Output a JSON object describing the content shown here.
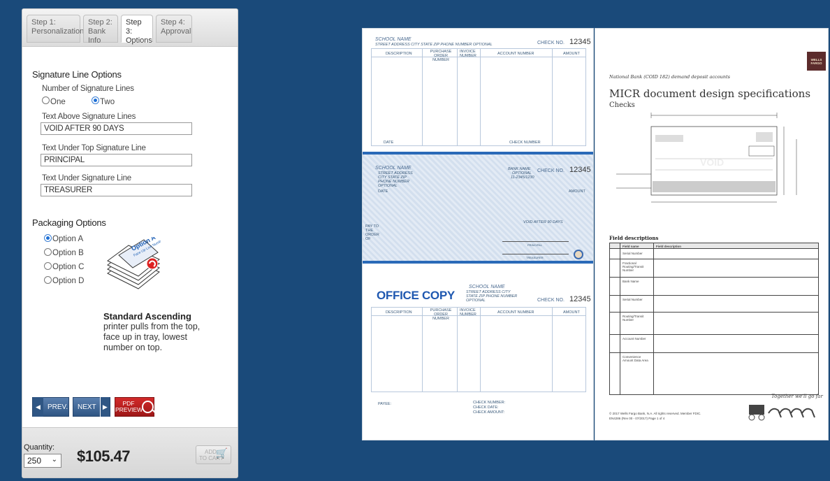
{
  "tabs": [
    {
      "step": "Step 1:",
      "name": "Personalization"
    },
    {
      "step": "Step 2:",
      "name": "Bank Info"
    },
    {
      "step": "Step 3:",
      "name": "Options"
    },
    {
      "step": "Step 4:",
      "name": "Approval"
    }
  ],
  "signature": {
    "title": "Signature Line Options",
    "num_lines_label": "Number of Signature Lines",
    "option_one": "One",
    "option_two": "Two",
    "selected": "Two",
    "text_above_label": "Text Above Signature Lines",
    "text_above_value": "VOID AFTER 90 DAYS",
    "text_under_top_label": "Text Under Top Signature Line",
    "text_under_top_value": "PRINCIPAL",
    "text_under_label": "Text Under Signature Line",
    "text_under_value": "TREASURER"
  },
  "packaging": {
    "title": "Packaging Options",
    "options": [
      "Option A",
      "Option B",
      "Option C",
      "Option D"
    ],
    "selected": "Option A",
    "image_title": "Option A",
    "image_subtitle": "Face Up Low Number",
    "desc_title": "Standard Ascending",
    "desc_body": "printer pulls from the top, face up in tray, lowest number on top."
  },
  "nav": {
    "prev": "PREV.",
    "next": "NEXT",
    "pdf_line1": "PDF",
    "pdf_line2": "PREVIEW"
  },
  "footer": {
    "quantity_label": "Quantity:",
    "quantity_value": "250",
    "price": "$105.47",
    "cart_line1": "ADD",
    "cart_line2": "TO CART"
  },
  "check_doc": {
    "school_name": "SCHOOL NAME",
    "school_address": "STREET ADDRESS CITY STATE ZIP PHONE NUMBER OPTIONAL",
    "check_no_label": "CHECK NO.",
    "check_number": "12345",
    "col_description": "DESCRIPTION",
    "col_purchase": "PURCHASE ORDER NUMBER",
    "col_invoice": "INVOICE NUMBER",
    "col_account": "ACCOUNT NUMBER",
    "col_amount": "AMOUNT",
    "date": "DATE",
    "check_number_label": "CHECK NUMBER",
    "bank_name": "BANK NAME",
    "bank_optional": "OPTIONAL",
    "bank_code": "11-2345/1230",
    "check_date": "DATE",
    "check_amount": "AMOUNT",
    "pay_to": "PAY TO THE ORDER OF",
    "void_text": "VOID AFTER 90 DAYS",
    "principal": "PRINCIPAL",
    "treasurer": "TREASURER",
    "office_copy": "OFFICE COPY",
    "payee": "PAYEE:",
    "check_number_footer": "CHECK NUMBER:",
    "check_date_footer": "CHECK DATE:",
    "check_amount_footer": "CHECK AMOUNT:"
  },
  "spec_doc": {
    "logo": "WELLS FARGO",
    "subtitle": "National Bank (COID 182) demand deposit accounts",
    "title": "MICR document design specifications",
    "heading": "Checks",
    "void_mark": "VOID",
    "field_heading": "Field descriptions",
    "col_field": "Field name",
    "col_desc": "Field description",
    "fields": [
      "Serial Number",
      "Fractional Routing/Transit Number",
      "Bank Name",
      "Serial Number",
      "Routing/Transit Number",
      "Account Number",
      "Convenience Amount Data Area"
    ],
    "tagline": "Together we'll go far",
    "copyright": "© 2017 Wells Fargo Bank, N.A. All rights reserved. Member FDIC.",
    "form_code": "EN4286 (Rev 00 - 07/2017)  Page 1 of 4"
  }
}
